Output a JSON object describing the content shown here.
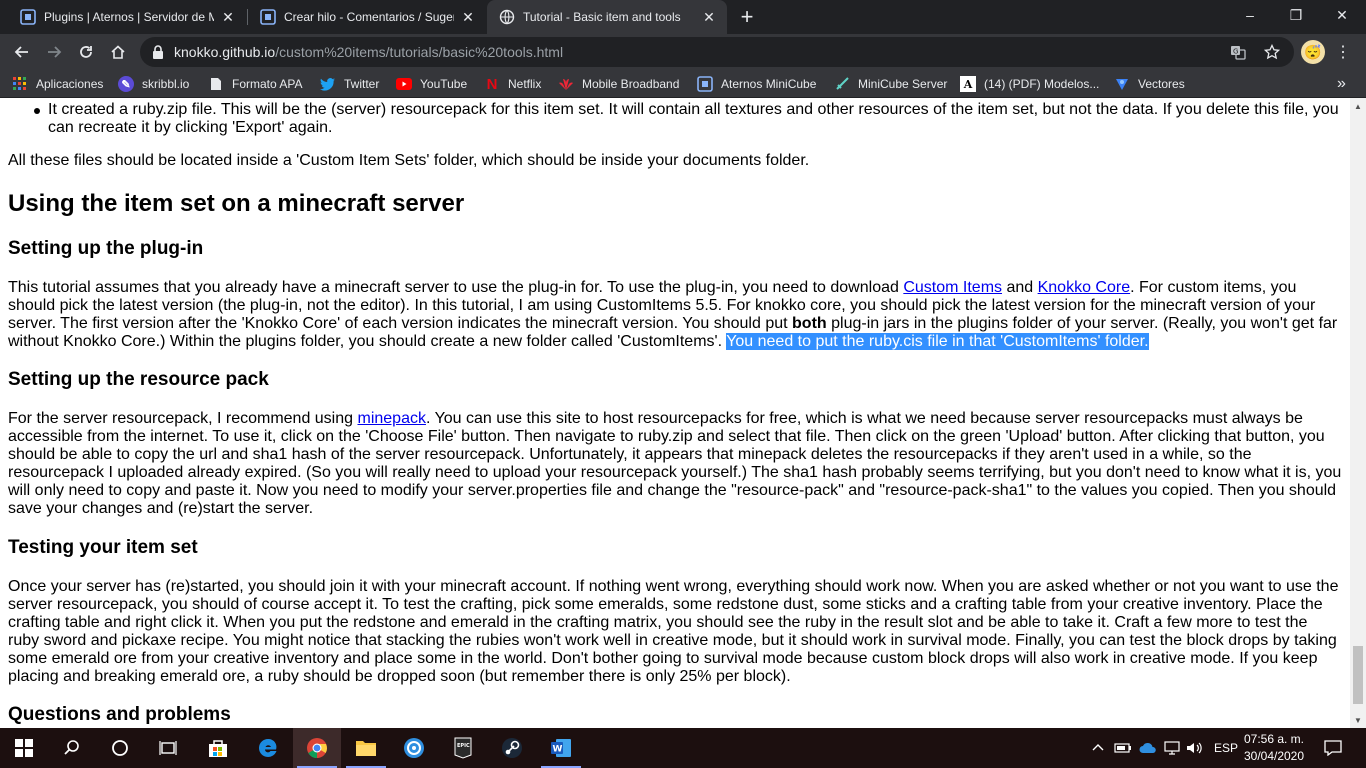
{
  "tabs": [
    {
      "title": "Plugins | Aternos | Servidor de Minecraft",
      "active": false
    },
    {
      "title": "Crear hilo - Comentarios / Sugerencias",
      "active": false
    },
    {
      "title": "Tutorial - Basic item and tools",
      "active": true
    }
  ],
  "window": {
    "minimize": "–",
    "maximize": "❐",
    "close": "✕"
  },
  "address": {
    "host": "knokko.github.io",
    "path": "/custom%20items/tutorials/basic%20tools.html"
  },
  "bookmarks": [
    {
      "label": "Aplicaciones",
      "icon": "apps-grid-icon"
    },
    {
      "label": "skribbl.io",
      "icon": "skribbl-icon"
    },
    {
      "label": "Formato APA",
      "icon": "bookmark-doc-icon"
    },
    {
      "label": "Twitter",
      "icon": "twitter-icon"
    },
    {
      "label": "YouTube",
      "icon": "youtube-icon"
    },
    {
      "label": "Netflix",
      "icon": "netflix-icon"
    },
    {
      "label": "Mobile Broadband",
      "icon": "huawei-icon"
    },
    {
      "label": "Aternos MiniCube",
      "icon": "aternos-icon"
    },
    {
      "label": "MiniCube Server",
      "icon": "sword-icon"
    },
    {
      "label": "(14) (PDF) Modelos...",
      "icon": "academia-icon"
    },
    {
      "label": "Vectores",
      "icon": "vectores-icon"
    }
  ],
  "bookmarks_more": "»",
  "page": {
    "li_text": "It created a ruby.zip file. This will be the (server) resourcepack for this item set. It will contain all textures and other resources of the item set, but not the data. If you delete this file, you can recreate it by clicking 'Export' again.",
    "files_location": "All these files should be located inside a 'Custom Item Sets' folder, which should be inside your documents folder.",
    "h2": "Using the item set on a minecraft server",
    "plugin": {
      "heading": "Setting up the plug-in",
      "t1": "This tutorial assumes that you already have a minecraft server to use the plug-in for. To use the plug-in, you need to download ",
      "link1": "Custom Items",
      "t2": " and ",
      "link2": "Knokko Core",
      "t3": ". For custom items, you should pick the latest version (the plug-in, not the editor). In this tutorial, I am using CustomItems 5.5. For knokko core, you should pick the latest version for the minecraft version of your server. The first version after the 'Knokko Core' of each version indicates the minecraft version. You should put ",
      "bold": "both",
      "t4": " plug-in jars in the plugins folder of your server. (Really, you won't get far without Knokko Core.) Within the plugins folder, you should create a new folder called 'CustomItems'. ",
      "selected": "You need to put the ruby.cis file in that 'CustomItems' folder."
    },
    "resource": {
      "heading": "Setting up the resource pack",
      "t1": "For the server resourcepack, I recommend using ",
      "link": "minepack",
      "t2": ". You can use this site to host resourcepacks for free, which is what we need because server resourcepacks must always be accessible from the internet. To use it, click on the 'Choose File' button. Then navigate to ruby.zip and select that file. Then click on the green 'Upload' button. After clicking that button, you should be able to copy the url and sha1 hash of the server resourcepack. Unfortunately, it appears that minepack deletes the resourcepacks if they aren't used in a while, so the resourcepack I uploaded already expired. (So you will really need to upload your resourcepack yourself.) The sha1 hash probably seems terrifying, but you don't need to know what it is, you will only need to copy and paste it. Now you need to modify your server.properties file and change the \"resource-pack\" and \"resource-pack-sha1\" to the values you copied. Then you should save your changes and (re)start the server."
    },
    "testing": {
      "heading": "Testing your item set",
      "text": "Once your server has (re)started, you should join it with your minecraft account. If nothing went wrong, everything should work now. When you are asked whether or not you want to use the server resourcepack, you should of course accept it. To test the crafting, pick some emeralds, some redstone dust, some sticks and a crafting table from your creative inventory. Place the crafting table and right click it. When you put the redstone and emerald in the crafting matrix, you should see the ruby in the result slot and be able to take it. Craft a few more to test the ruby sword and pickaxe recipe. You might notice that stacking the rubies won't work well in creative mode, but it should work in survival mode. Finally, you can test the block drops by taking some emerald ore from your creative inventory and place some in the world. Don't bother going to survival mode because custom block drops will also work in creative mode. If you keep placing and breaking emerald ore, a ruby should be dropped soon (but remember there is only 25% per block)."
    },
    "questions_heading": "Questions and problems"
  },
  "taskbar": {
    "lang": "ESP",
    "time": "07:56 a. m.",
    "date": "30/04/2020"
  },
  "colors": {
    "chrome_dark": "#202124",
    "chrome_toolbar": "#35363a",
    "link": "#0000ee",
    "selection": "#3390ff",
    "taskbar": "#1c0f0f"
  }
}
